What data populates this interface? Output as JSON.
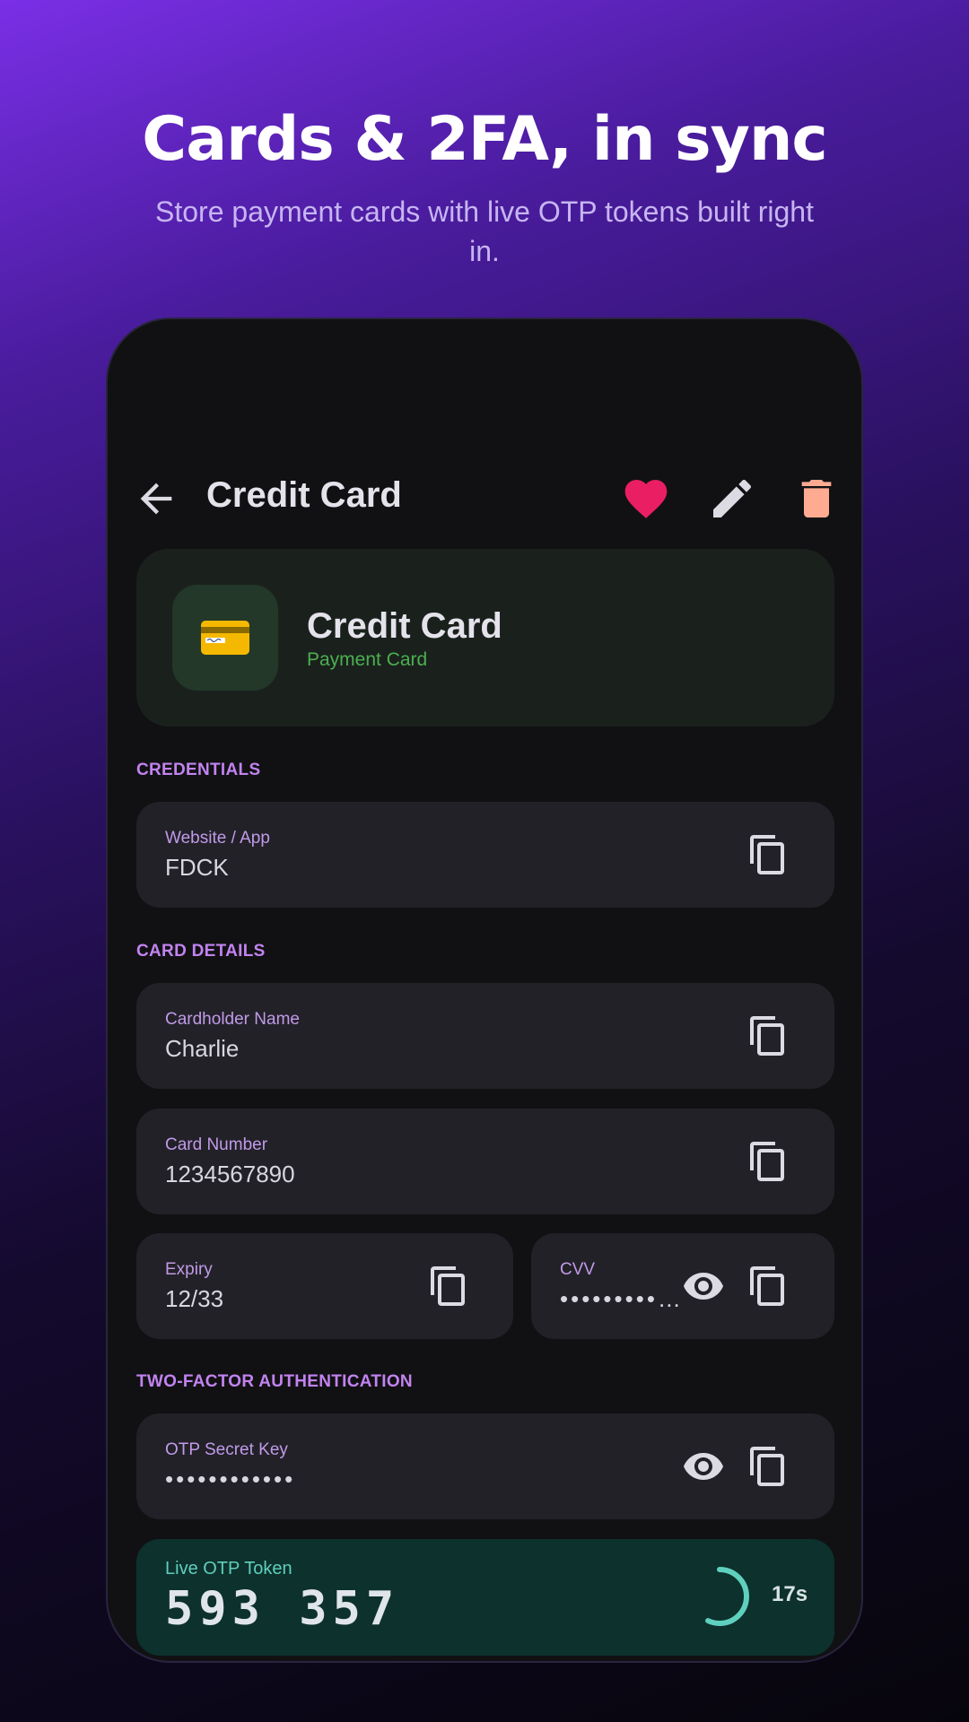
{
  "promo": {
    "headline": "Cards & 2FA, in sync",
    "subline": "Store payment cards with live OTP tokens built right in."
  },
  "appbar": {
    "title": "Credit Card",
    "icons": [
      "arrow-back-icon",
      "heart-icon",
      "pencil-icon",
      "trash-icon"
    ]
  },
  "hero": {
    "title": "Credit Card",
    "subtitle": "Payment Card",
    "icon": "credit-card-emoji"
  },
  "sections": {
    "credentials": "CREDENTIALS",
    "card_details": "CARD DETAILS",
    "two_factor": "TWO-FACTOR AUTHENTICATION"
  },
  "fields": {
    "website": {
      "label": "Website / App",
      "value": "FDCK"
    },
    "cardholder": {
      "label": "Cardholder Name",
      "value": "Charlie"
    },
    "card_number": {
      "label": "Card Number",
      "value": "1234567890"
    },
    "expiry": {
      "label": "Expiry",
      "value": "12/33"
    },
    "cvv": {
      "label": "CVV",
      "value": "•••••••••…"
    },
    "otp_secret": {
      "label": "OTP Secret Key",
      "value": "••••••••••••"
    }
  },
  "otp": {
    "label": "Live OTP Token",
    "code": "593 357",
    "seconds_left": "17s",
    "remaining_fraction": 0.57
  },
  "colors": {
    "accent_purple": "#c283f0",
    "favorite": "#e91e63",
    "delete": "#ffab91",
    "otp_accent": "#5fd0bd",
    "payment_green": "#4caf50"
  }
}
